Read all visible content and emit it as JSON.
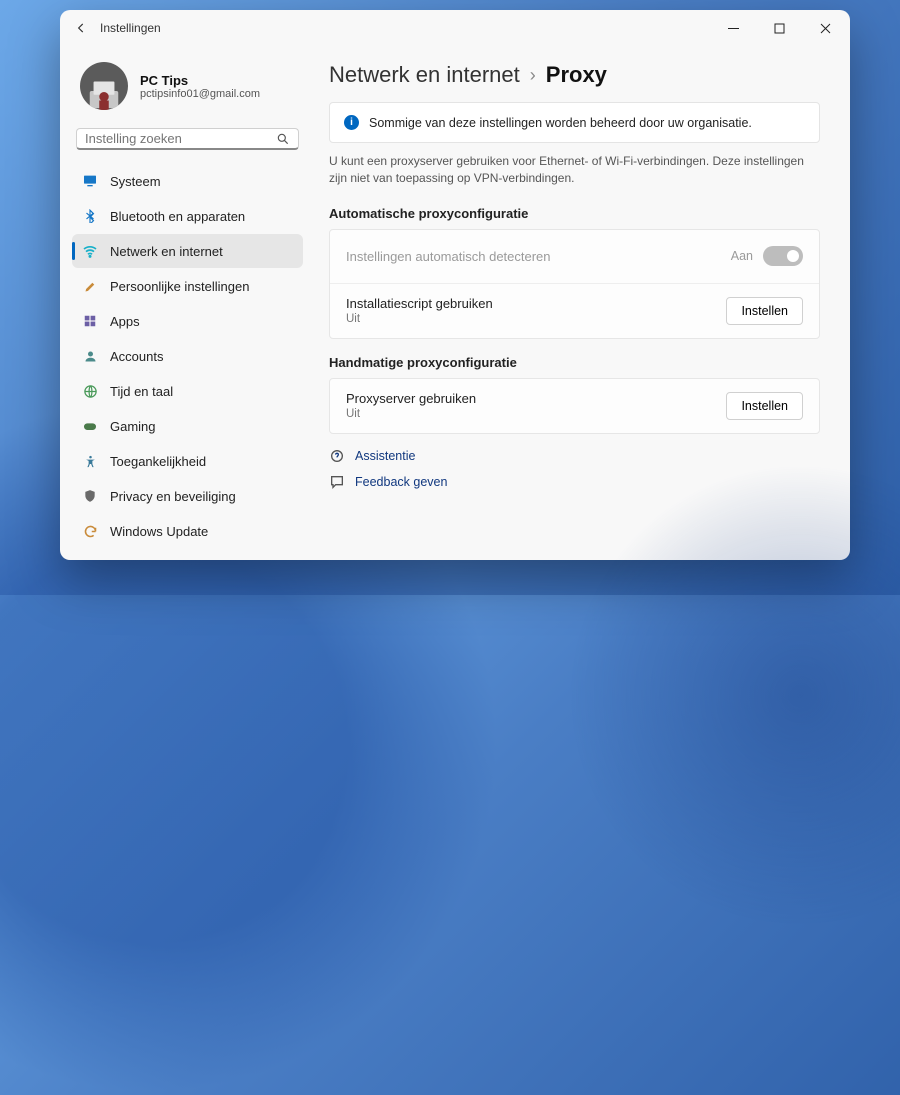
{
  "window": {
    "title": "Instellingen"
  },
  "profile": {
    "name": "PC Tips",
    "email": "pctipsinfo01@gmail.com"
  },
  "search": {
    "placeholder": "Instelling zoeken"
  },
  "sidebar": {
    "items": [
      {
        "label": "Systeem"
      },
      {
        "label": "Bluetooth en apparaten"
      },
      {
        "label": "Netwerk en internet"
      },
      {
        "label": "Persoonlijke instellingen"
      },
      {
        "label": "Apps"
      },
      {
        "label": "Accounts"
      },
      {
        "label": "Tijd en taal"
      },
      {
        "label": "Gaming"
      },
      {
        "label": "Toegankelijkheid"
      },
      {
        "label": "Privacy en beveiliging"
      },
      {
        "label": "Windows Update"
      }
    ]
  },
  "breadcrumb": {
    "parent": "Netwerk en internet",
    "current": "Proxy"
  },
  "banner": {
    "text": "Sommige van deze instellingen worden beheerd door uw organisatie."
  },
  "description": "U kunt een proxyserver gebruiken voor Ethernet- of Wi-Fi-verbindingen. Deze instellingen zijn niet van toepassing op VPN-verbindingen.",
  "sections": {
    "auto": {
      "title": "Automatische proxyconfiguratie",
      "detect": {
        "label": "Instellingen automatisch detecteren",
        "state": "Aan"
      },
      "script": {
        "label": "Installatiescript gebruiken",
        "sub": "Uit",
        "button": "Instellen"
      }
    },
    "manual": {
      "title": "Handmatige proxyconfiguratie",
      "server": {
        "label": "Proxyserver gebruiken",
        "sub": "Uit",
        "button": "Instellen"
      }
    }
  },
  "footer": {
    "help": "Assistentie",
    "feedback": "Feedback geven"
  }
}
